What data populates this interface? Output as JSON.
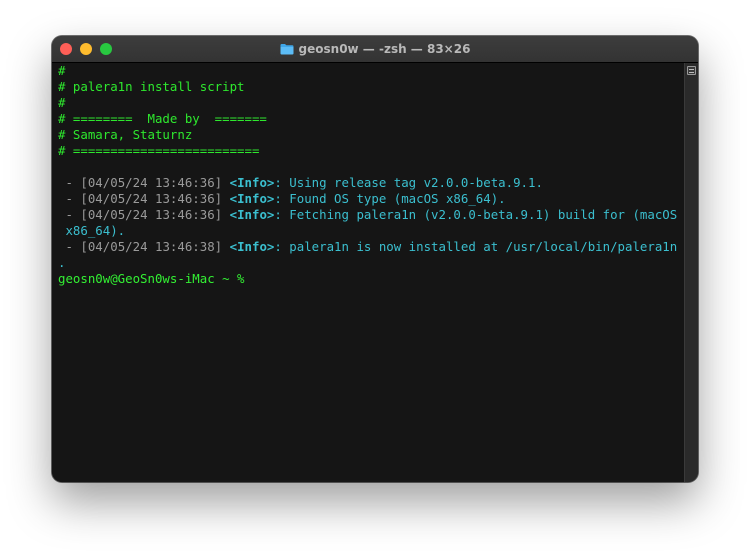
{
  "window": {
    "title": "geosn0w — -zsh — 83×26"
  },
  "icons": {
    "title_folder": "folder-icon",
    "scroll": "scroll-indicator-icon"
  },
  "colors": {
    "terminal_bg": "#151515",
    "green": "#2ee82e",
    "cyan": "#3bbfcf",
    "gray": "#9a9a9a"
  },
  "terminal": {
    "header_lines": [
      "#",
      "# palera1n install script",
      "#",
      "# ========  Made by  =======",
      "# Samara, Staturnz",
      "# ========================="
    ],
    "log_lines": [
      {
        "prefix": " - ",
        "timestamp": "[04/05/24 13:46:36]",
        "tag": "<Info>",
        "colon": ":",
        "message": " Using release tag v2.0.0-beta.9.1."
      },
      {
        "prefix": " - ",
        "timestamp": "[04/05/24 13:46:36]",
        "tag": "<Info>",
        "colon": ":",
        "message": " Found OS type (macOS x86_64)."
      },
      {
        "prefix": " - ",
        "timestamp": "[04/05/24 13:46:36]",
        "tag": "<Info>",
        "colon": ":",
        "message": " Fetching palera1n (v2.0.0-beta.9.1) build for (macOS",
        "wrap": " x86_64)."
      },
      {
        "prefix": " - ",
        "timestamp": "[04/05/24 13:46:38]",
        "tag": "<Info>",
        "colon": ":",
        "message": " palera1n is now installed at /usr/local/bin/palera1n",
        "wrap": "."
      }
    ],
    "prompt": "geosn0w@GeoSn0ws-iMac ~ %"
  }
}
